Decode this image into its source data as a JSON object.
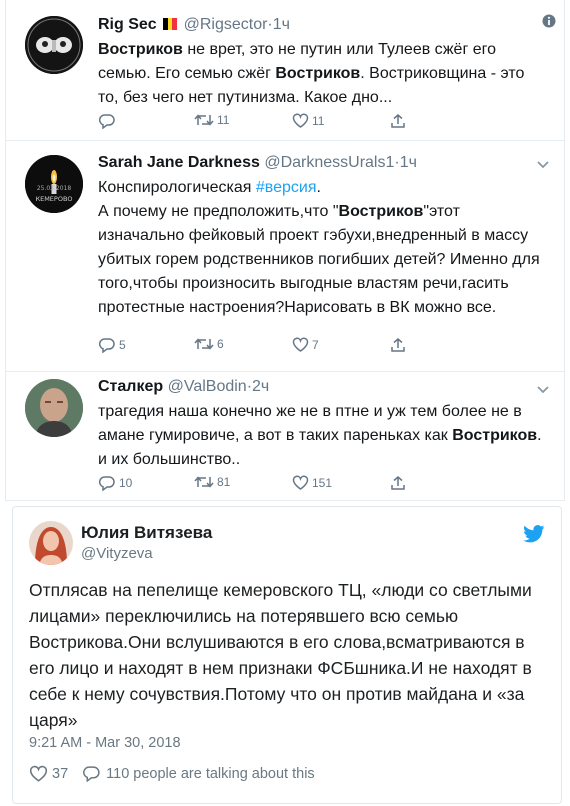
{
  "replies": [
    {
      "name": "Rig Sec",
      "handle": "@Rigsector",
      "time": "1ч",
      "text_parts": [
        {
          "b": "Востриков"
        },
        {
          "t": " не врет, это не путин или Тулеев сжёг его семью. Его семью сжёг "
        },
        {
          "b": "Востриков"
        },
        {
          "t": ". Востриковщина - это то, без чего нет путинизма. Какое дно..."
        }
      ],
      "reply_count": "",
      "retweet_count": "11",
      "like_count": "11",
      "menu_icon": "info-icon"
    },
    {
      "name": "Sarah Jane Darkness",
      "handle": "@DarknessUrals1",
      "time": "1ч",
      "avatar_text": "КЕМЕРОВО",
      "avatar_date": "25.03.2018",
      "text_parts": [
        {
          "t": "Конспирологическая "
        },
        {
          "tag": "#версия"
        },
        {
          "t": ".\nА почему не предположить,что \""
        },
        {
          "b": "Востриков"
        },
        {
          "t": "\"этот изначально фейковый проект гэбухи,внедренный в массу  убитых горем родственников погибших детей? Именно для того,чтобы произносить выгодные властям речи,гасить протестные настроения?Нарисовать в ВК можно все."
        }
      ],
      "reply_count": "5",
      "retweet_count": "6",
      "like_count": "7",
      "menu_icon": "chevron-down-icon"
    },
    {
      "name": "Сталкер",
      "handle": "@ValBodin",
      "time": "2ч",
      "text_parts": [
        {
          "t": "трагедия наша конечно же не в птне и уж тем более не в амане гумировиче, а вот в таких пареньках как "
        },
        {
          "b": "Востриков"
        },
        {
          "t": ". и их большинство.."
        }
      ],
      "reply_count": "10",
      "retweet_count": "81",
      "like_count": "151",
      "menu_icon": "chevron-down-icon"
    }
  ],
  "embed": {
    "name": "Юлия Витязева",
    "handle": "@Vityzeva",
    "text": "Отплясав на пепелище кемеровского ТЦ, «люди со светлыми лицами» переключились на потерявшего всю семью Вострикова.Они вслушиваются в его слова,всматриваются в его лицо и находят в нем признаки ФСБшника.И не находят в себе к нему сочувствия.Потому что он против майдана и «за царя»",
    "timestamp": "9:21 AM - Mar 30, 2018",
    "like_count": "37",
    "talking": "110 people are talking about this",
    "brand_icon": "twitter-bird-icon"
  },
  "colors": {
    "text": "#14171a",
    "secondary": "#657786",
    "link": "#1da1f2",
    "border": "#e6ecf0",
    "flag": [
      "#000000",
      "#fdda24",
      "#ef3340"
    ]
  }
}
